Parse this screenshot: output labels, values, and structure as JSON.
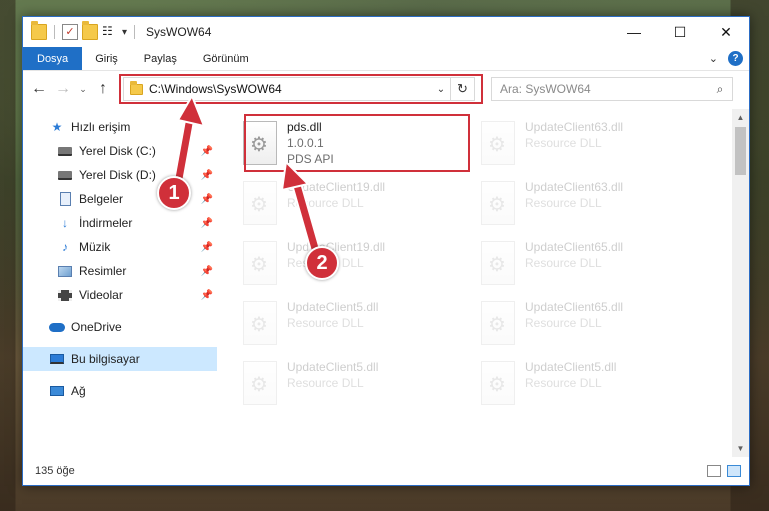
{
  "window": {
    "title": "SysWOW64",
    "controls": {
      "minimize": "—",
      "maximize": "☐",
      "close": "✕"
    }
  },
  "ribbon": {
    "tabs": [
      "Dosya",
      "Giriş",
      "Paylaş",
      "Görünüm"
    ],
    "help": "?"
  },
  "address": {
    "path": "C:\\Windows\\SysWOW64",
    "search_placeholder": "Ara: SysWOW64"
  },
  "nav": {
    "quick_access": "Hızlı erişim",
    "items": [
      {
        "label": "Yerel Disk (C:)"
      },
      {
        "label": "Yerel Disk (D:)"
      },
      {
        "label": "Belgeler"
      },
      {
        "label": "İndirmeler"
      },
      {
        "label": "Müzik"
      },
      {
        "label": "Resimler"
      },
      {
        "label": "Videolar"
      }
    ],
    "onedrive": "OneDrive",
    "this_pc": "Bu bilgisayar",
    "network": "Ağ"
  },
  "files": [
    {
      "name": "pds.dll",
      "line1": "1.0.0.1",
      "line2": "PDS API"
    },
    {
      "name": "UpdateClient63.dll",
      "line1": "Resource DLL"
    },
    {
      "name": "UpdateClient19.dll",
      "line1": "Resource DLL"
    },
    {
      "name": "UpdateClient63.dll",
      "line1": "Resource DLL"
    },
    {
      "name": "UpdateClient19.dll",
      "line1": "Resource DLL"
    },
    {
      "name": "UpdateClient65.dll",
      "line1": "Resource DLL"
    },
    {
      "name": "UpdateClient5.dll",
      "line1": "Resource DLL"
    },
    {
      "name": "UpdateClient65.dll",
      "line1": "Resource DLL"
    },
    {
      "name": "UpdateClient5.dll",
      "line1": "Resource DLL"
    },
    {
      "name": "UpdateClient5.dll",
      "line1": "Resource DLL"
    }
  ],
  "status": {
    "count": "135 öğe"
  },
  "annotations": {
    "step1": "1",
    "step2": "2",
    "accent": "#d0303a"
  }
}
